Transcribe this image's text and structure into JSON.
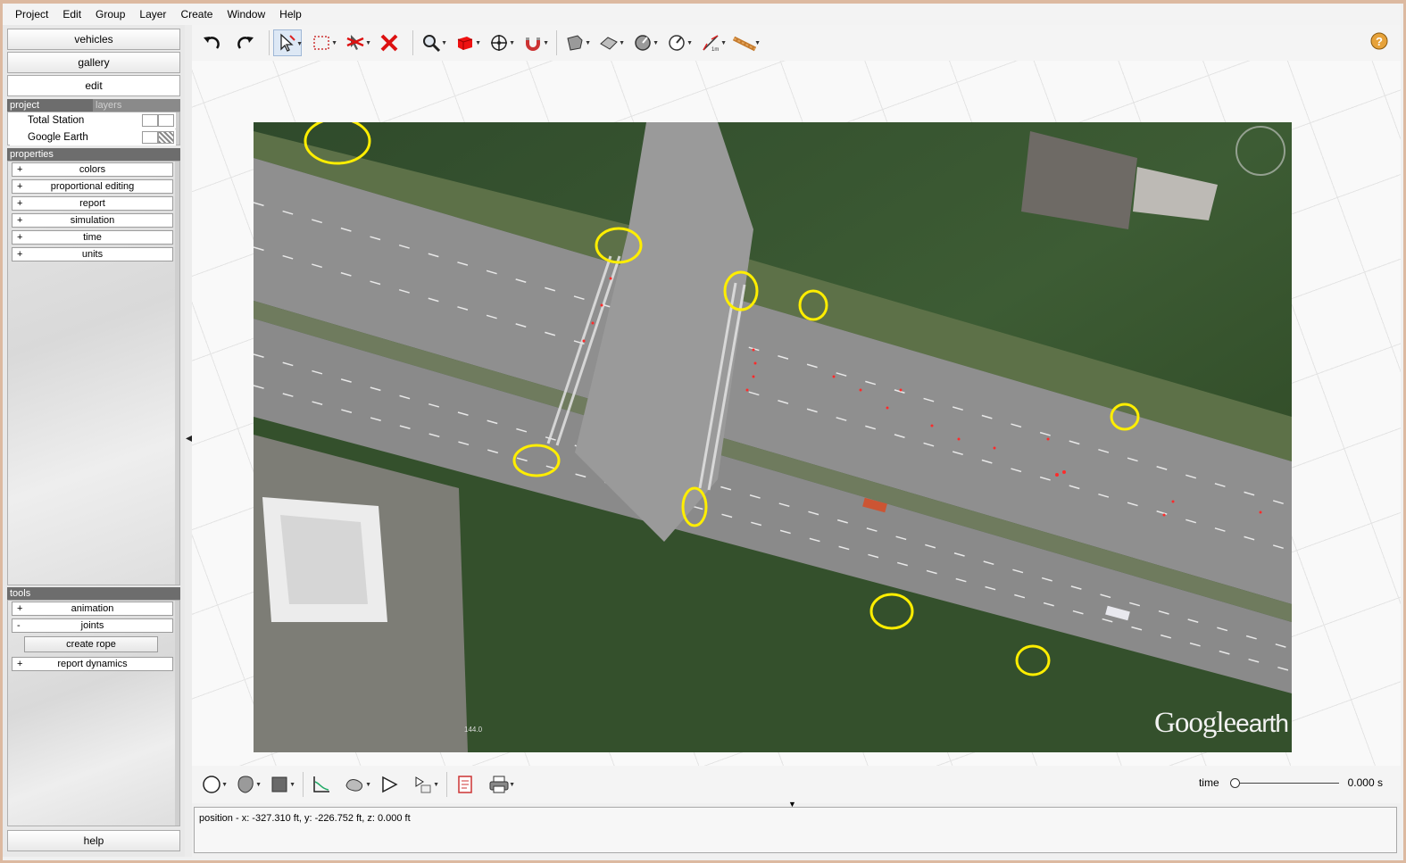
{
  "menu": [
    "Project",
    "Edit",
    "Group",
    "Layer",
    "Create",
    "Window",
    "Help"
  ],
  "left_panel": {
    "buttons": {
      "vehicles": "vehicles",
      "gallery": "gallery",
      "edit": "edit",
      "help": "help"
    },
    "tabs": {
      "project": "project",
      "layers": "layers"
    },
    "layers": [
      "Total Station",
      "Google Earth"
    ],
    "properties_header": "properties",
    "properties": [
      "colors",
      "proportional editing",
      "report",
      "simulation",
      "time",
      "units"
    ],
    "tools_header": "tools",
    "tools": {
      "animation": "animation",
      "joints": "joints",
      "create_rope": "create rope",
      "report_dynamics": "report dynamics"
    },
    "expander_plus": "+",
    "expander_minus": "-"
  },
  "toolbar_icons": [
    "undo-icon",
    "redo-icon",
    "select-arrow-icon",
    "box-select-icon",
    "delete-arrow-icon",
    "delete-x-icon",
    "zoom-icon",
    "cube-icon",
    "move-icon",
    "magnet-icon",
    "plane-icon",
    "surface-icon",
    "tape-dial-icon",
    "dial-icon",
    "measure-icon",
    "rope-icon",
    "help-icon"
  ],
  "viewport": {
    "map_watermark": {
      "main": "Google",
      "sub": "earth"
    },
    "scale_label": "144.0",
    "colors": {
      "highlight": "#ffee00",
      "marker": "#ff2b2b"
    }
  },
  "bottom_toolbar": {
    "time_label": "time",
    "time_value": "0.000 s",
    "time_position": 0.0
  },
  "status": {
    "position_text": "position - x: -327.310 ft, y: -226.752 ft, z: 0.000 ft"
  }
}
